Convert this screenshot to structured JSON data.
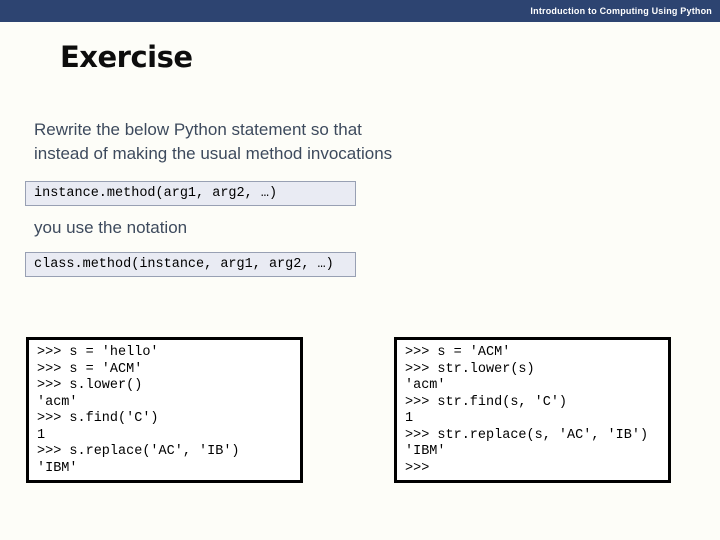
{
  "header": {
    "title": "Introduction to Computing Using Python",
    "bar_color": "#2D4471"
  },
  "slide": {
    "title": "Exercise",
    "paragraph_line1": "Rewrite the below Python statement so that",
    "paragraph_line2": "instead of making the usual method invocations",
    "notation_text": "you use the notation",
    "code_box_instance": "instance.method(arg1, arg2, …)",
    "code_box_class": "class.method(instance, arg1, arg2, …)",
    "terminal_left": ">>> s = 'hello'\n>>> s = 'ACM'\n>>> s.lower()\n'acm'\n>>> s.find('C')\n1\n>>> s.replace('AC', 'IB')\n'IBM'",
    "terminal_right": ">>> s = 'ACM'\n>>> str.lower(s)\n'acm'\n>>> str.find(s, 'C')\n1\n>>> str.replace(s, 'AC', 'IB')\n'IBM'\n>>>",
    "colors": {
      "body_text": "#3D4A5D",
      "code_box_bg": "#E9EBF3",
      "code_box_border": "#98A0B3",
      "terminal_border": "#000000",
      "slide_background": "#FDFDF8"
    }
  }
}
